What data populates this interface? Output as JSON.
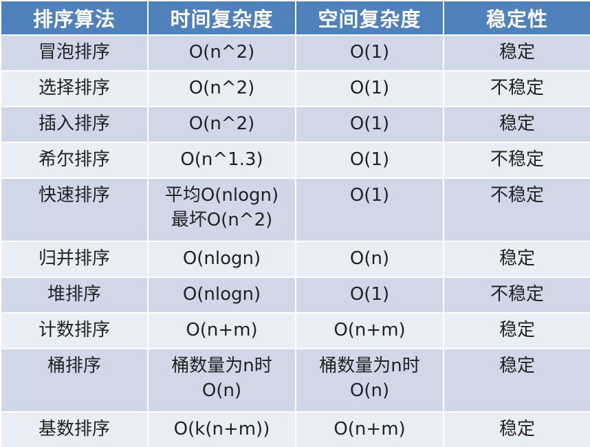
{
  "table": {
    "headers": [
      "排序算法",
      "时间复杂度",
      "空间复杂度",
      "稳定性"
    ],
    "rows": [
      {
        "algo": "冒泡排序",
        "time": [
          "O(n^2)"
        ],
        "space": [
          "O(1)"
        ],
        "stable": "稳定"
      },
      {
        "algo": "选择排序",
        "time": [
          "O(n^2)"
        ],
        "space": [
          "O(1)"
        ],
        "stable": "不稳定"
      },
      {
        "algo": "插入排序",
        "time": [
          "O(n^2)"
        ],
        "space": [
          "O(1)"
        ],
        "stable": "稳定"
      },
      {
        "algo": "希尔排序",
        "time": [
          "O(n^1.3)"
        ],
        "space": [
          "O(1)"
        ],
        "stable": "不稳定"
      },
      {
        "algo": "快速排序",
        "time": [
          "平均O(nlogn)",
          "最坏O(n^2)"
        ],
        "space": [
          "O(1)"
        ],
        "stable": "不稳定"
      },
      {
        "algo": "归并排序",
        "time": [
          "O(nlogn)"
        ],
        "space": [
          "O(n)"
        ],
        "stable": "稳定"
      },
      {
        "algo": "堆排序",
        "time": [
          "O(nlogn)"
        ],
        "space": [
          "O(1)"
        ],
        "stable": "不稳定"
      },
      {
        "algo": "计数排序",
        "time": [
          "O(n+m)"
        ],
        "space": [
          "O(n+m)"
        ],
        "stable": "稳定"
      },
      {
        "algo": "桶排序",
        "time": [
          "桶数量为n时",
          "O(n)"
        ],
        "space": [
          "桶数量为n时",
          "O(n)"
        ],
        "stable": "稳定"
      },
      {
        "algo": "基数排序",
        "time": [
          "O(k(n+m))"
        ],
        "space": [
          "O(n+m)"
        ],
        "stable": "稳定"
      }
    ]
  },
  "colors": {
    "header_bg": "#4f81bd",
    "row_odd_bg": "#d0d8e8",
    "row_even_bg": "#e9edf4"
  }
}
